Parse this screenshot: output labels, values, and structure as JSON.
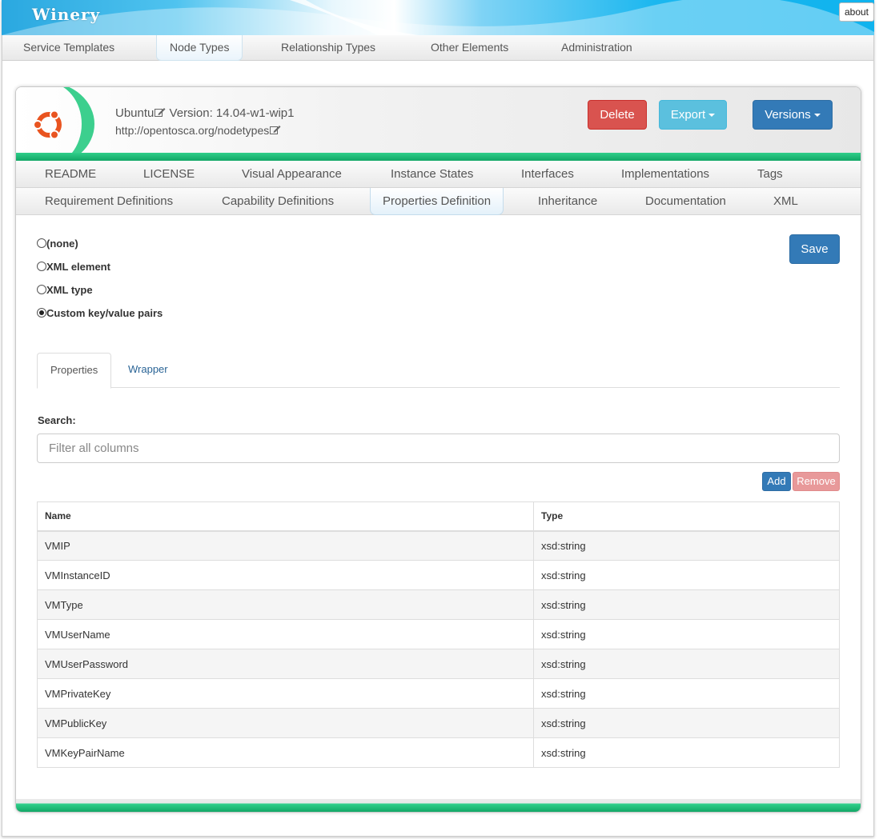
{
  "app": {
    "brand": "Winery",
    "about_label": "about"
  },
  "main_nav": {
    "tabs": [
      {
        "label": "Service Templates"
      },
      {
        "label": "Node Types",
        "active": true
      },
      {
        "label": "Relationship Types"
      },
      {
        "label": "Other Elements"
      },
      {
        "label": "Administration"
      }
    ]
  },
  "entity": {
    "name": "Ubuntu",
    "version_label": "Version: 14.04-w1-wip1",
    "namespace": "http://opentosca.org/nodetypes",
    "logo_icon": "ubuntu-logo-icon",
    "edit_icon": "edit-icon"
  },
  "actions": {
    "delete_label": "Delete",
    "export_label": "Export",
    "versions_label": "Versions"
  },
  "sub_nav": {
    "row1": [
      "README",
      "LICENSE",
      "Visual Appearance",
      "Instance States",
      "Interfaces",
      "Implementations",
      "Tags"
    ],
    "row2": [
      "Requirement Definitions",
      "Capability Definitions",
      "Properties Definition",
      "Inheritance",
      "Documentation",
      "XML"
    ],
    "active": "Properties Definition"
  },
  "properties_definition": {
    "options": [
      {
        "label": "(none)",
        "checked": false
      },
      {
        "label": "XML element",
        "checked": false
      },
      {
        "label": "XML type",
        "checked": false
      },
      {
        "label": "Custom key/value pairs",
        "checked": true
      }
    ],
    "save_label": "Save",
    "tabs": [
      {
        "label": "Properties",
        "active": true
      },
      {
        "label": "Wrapper",
        "active": false
      }
    ],
    "search_label": "Search:",
    "search_placeholder": "Filter all columns",
    "add_label": "Add",
    "remove_label": "Remove",
    "table": {
      "headers": [
        "Name",
        "Type"
      ],
      "rows": [
        [
          "VMIP",
          "xsd:string"
        ],
        [
          "VMInstanceID",
          "xsd:string"
        ],
        [
          "VMType",
          "xsd:string"
        ],
        [
          "VMUserName",
          "xsd:string"
        ],
        [
          "VMUserPassword",
          "xsd:string"
        ],
        [
          "VMPrivateKey",
          "xsd:string"
        ],
        [
          "VMPublicKey",
          "xsd:string"
        ],
        [
          "VMKeyPairName",
          "xsd:string"
        ]
      ]
    }
  },
  "colors": {
    "banner": "#1bb7ef",
    "accent_green": "#12a766",
    "primary": "#337ab7",
    "danger": "#d9534f",
    "info": "#5bc0de"
  }
}
